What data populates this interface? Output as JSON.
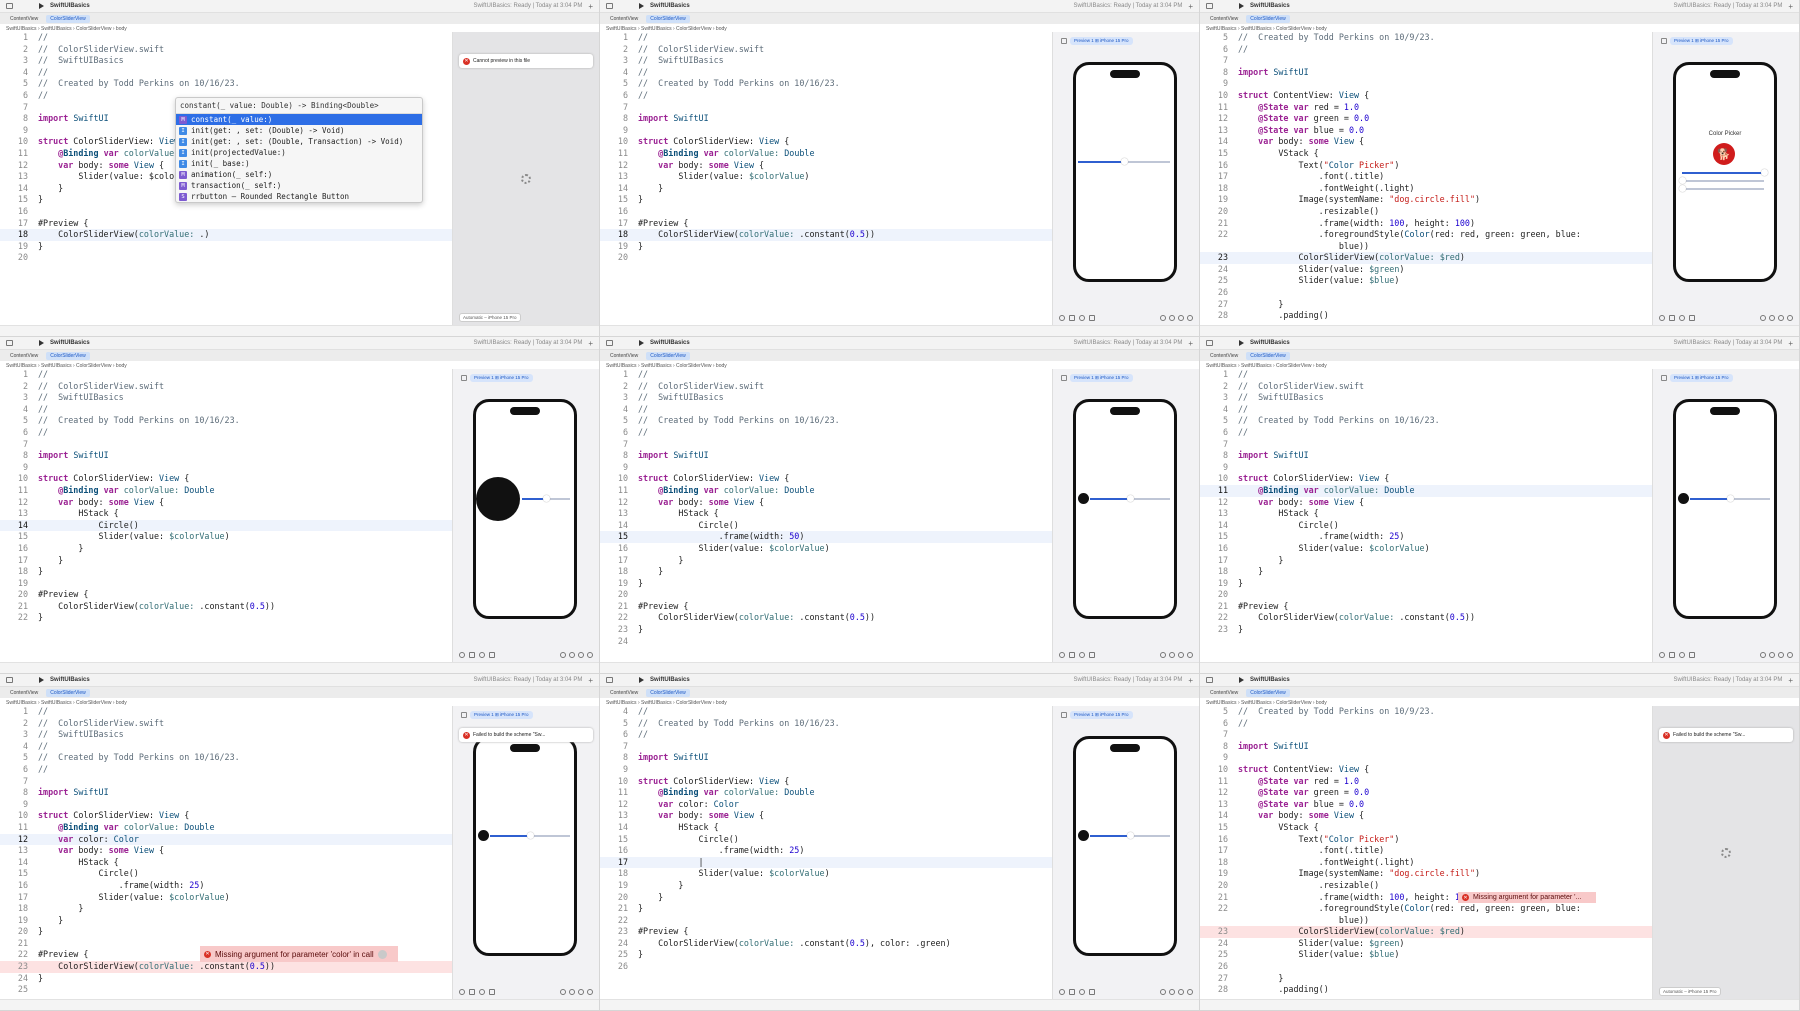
{
  "toolbar": {
    "project": "SwiftUIBasics",
    "status": "SwiftUIBasics: Ready | Today at 3:04 PM"
  },
  "tabs": [
    "ContentView",
    "ColorSliderView"
  ],
  "breadcrumb": "SwiftUIBasics  ›  SwiftUIBasics  ›  ColorSliderView  ›  body",
  "preview_pill": "Preview 1  ⊞ iPhone 15 Pro",
  "device_pill": "Automatic – iPhone 15 Pro",
  "errors": {
    "cannot_preview": "Cannot preview in this file",
    "failed_build": "Failed to build the scheme \"Sw...",
    "missing_color": "Missing argument for parameter 'color' in call",
    "missing_short": "Missing argument for parameter '..."
  },
  "autocomplete": {
    "signature": "constant(_ value: Double) -> Binding<Double>",
    "items": [
      {
        "badge": "M",
        "text": "constant(_ value:)"
      },
      {
        "badge": "I",
        "text": "init(get: , set: (Double) -> Void)"
      },
      {
        "badge": "I",
        "text": "init(get: , set: (Double, Transaction) -> Void)"
      },
      {
        "badge": "I",
        "text": "init(projectedValue:)"
      },
      {
        "badge": "I",
        "text": "init(_ base:)"
      },
      {
        "badge": "M",
        "text": "animation(_ self:)"
      },
      {
        "badge": "M",
        "text": "transaction(_ self:)"
      },
      {
        "badge": "S",
        "text": "rrbutton – Rounded Rectangle Button"
      }
    ]
  },
  "color_picker_title": "Color Picker",
  "panes": [
    {
      "hl": 18,
      "err": 0,
      "lines": [
        [
          "1",
          "//"
        ],
        [
          "2",
          "//  ColorSliderView.swift"
        ],
        [
          "3",
          "//  SwiftUIBasics"
        ],
        [
          "4",
          "//"
        ],
        [
          "5",
          "//  Created by Todd Perkins on 10/16/23."
        ],
        [
          "6",
          "//"
        ],
        [
          "7",
          ""
        ],
        [
          "8",
          "import SwiftUI"
        ],
        [
          "9",
          ""
        ],
        [
          "10",
          "struct ColorSliderView: View {"
        ],
        [
          "11",
          "    @Binding var colorValue: "
        ],
        [
          "12",
          "    var body: some View {"
        ],
        [
          "13",
          "        Slider(value: $colorVal"
        ],
        [
          "14",
          "    }"
        ],
        [
          "15",
          "}"
        ],
        [
          "16",
          ""
        ],
        [
          "17",
          "#Preview {"
        ],
        [
          "18",
          "    ColorSliderView(colorValue: .)"
        ],
        [
          "19",
          "}"
        ],
        [
          "20",
          ""
        ]
      ]
    },
    {
      "hl": 18,
      "err": 0,
      "lines": [
        [
          "1",
          "//"
        ],
        [
          "2",
          "//  ColorSliderView.swift"
        ],
        [
          "3",
          "//  SwiftUIBasics"
        ],
        [
          "4",
          "//"
        ],
        [
          "5",
          "//  Created by Todd Perkins on 10/16/23."
        ],
        [
          "6",
          "//"
        ],
        [
          "7",
          ""
        ],
        [
          "8",
          "import SwiftUI"
        ],
        [
          "9",
          ""
        ],
        [
          "10",
          "struct ColorSliderView: View {"
        ],
        [
          "11",
          "    @Binding var colorValue: Double"
        ],
        [
          "12",
          "    var body: some View {"
        ],
        [
          "13",
          "        Slider(value: $colorValue)"
        ],
        [
          "14",
          "    }"
        ],
        [
          "15",
          "}"
        ],
        [
          "16",
          ""
        ],
        [
          "17",
          "#Preview {"
        ],
        [
          "18",
          "    ColorSliderView(colorValue: .constant(0.5))"
        ],
        [
          "19",
          "}"
        ],
        [
          "20",
          ""
        ]
      ]
    },
    {
      "hl": 23,
      "err": 0,
      "lines": [
        [
          "5",
          "//  Created by Todd Perkins on 10/9/23."
        ],
        [
          "6",
          "//"
        ],
        [
          "7",
          ""
        ],
        [
          "8",
          "import SwiftUI"
        ],
        [
          "9",
          ""
        ],
        [
          "10",
          "struct ContentView: View {"
        ],
        [
          "11",
          "    @State var red = 1.0"
        ],
        [
          "12",
          "    @State var green = 0.0"
        ],
        [
          "13",
          "    @State var blue = 0.0"
        ],
        [
          "14",
          "    var body: some View {"
        ],
        [
          "15",
          "        VStack {"
        ],
        [
          "16",
          "            Text(\"Color Picker\")"
        ],
        [
          "17",
          "                .font(.title)"
        ],
        [
          "18",
          "                .fontWeight(.light)"
        ],
        [
          "19",
          "            Image(systemName: \"dog.circle.fill\")"
        ],
        [
          "20",
          "                .resizable()"
        ],
        [
          "21",
          "                .frame(width: 100, height: 100)"
        ],
        [
          "22",
          "                .foregroundStyle(Color(red: red, green: green, blue:"
        ],
        [
          "",
          "                    blue))"
        ],
        [
          "23",
          "            ColorSliderView(colorValue: $red)"
        ],
        [
          "24",
          "            Slider(value: $green)"
        ],
        [
          "25",
          "            Slider(value: $blue)"
        ],
        [
          "26",
          ""
        ],
        [
          "27",
          "        }"
        ],
        [
          "28",
          "        .padding()"
        ]
      ]
    },
    {
      "hl": 14,
      "err": 0,
      "lines": [
        [
          "1",
          "//"
        ],
        [
          "2",
          "//  ColorSliderView.swift"
        ],
        [
          "3",
          "//  SwiftUIBasics"
        ],
        [
          "4",
          "//"
        ],
        [
          "5",
          "//  Created by Todd Perkins on 10/16/23."
        ],
        [
          "6",
          "//"
        ],
        [
          "7",
          ""
        ],
        [
          "8",
          "import SwiftUI"
        ],
        [
          "9",
          ""
        ],
        [
          "10",
          "struct ColorSliderView: View {"
        ],
        [
          "11",
          "    @Binding var colorValue: Double"
        ],
        [
          "12",
          "    var body: some View {"
        ],
        [
          "13",
          "        HStack {"
        ],
        [
          "14",
          "            Circle()"
        ],
        [
          "15",
          "            Slider(value: $colorValue)"
        ],
        [
          "16",
          "        }"
        ],
        [
          "17",
          "    }"
        ],
        [
          "18",
          "}"
        ],
        [
          "19",
          ""
        ],
        [
          "20",
          "#Preview {"
        ],
        [
          "21",
          "    ColorSliderView(colorValue: .constant(0.5))"
        ],
        [
          "22",
          "}"
        ]
      ]
    },
    {
      "hl": 15,
      "err": 0,
      "lines": [
        [
          "1",
          "//"
        ],
        [
          "2",
          "//  ColorSliderView.swift"
        ],
        [
          "3",
          "//  SwiftUIBasics"
        ],
        [
          "4",
          "//"
        ],
        [
          "5",
          "//  Created by Todd Perkins on 10/16/23."
        ],
        [
          "6",
          "//"
        ],
        [
          "7",
          ""
        ],
        [
          "8",
          "import SwiftUI"
        ],
        [
          "9",
          ""
        ],
        [
          "10",
          "struct ColorSliderView: View {"
        ],
        [
          "11",
          "    @Binding var colorValue: Double"
        ],
        [
          "12",
          "    var body: some View {"
        ],
        [
          "13",
          "        HStack {"
        ],
        [
          "14",
          "            Circle()"
        ],
        [
          "15",
          "                .frame(width: 50)"
        ],
        [
          "16",
          "            Slider(value: $colorValue)"
        ],
        [
          "17",
          "        }"
        ],
        [
          "18",
          "    }"
        ],
        [
          "19",
          "}"
        ],
        [
          "20",
          ""
        ],
        [
          "21",
          "#Preview {"
        ],
        [
          "22",
          "    ColorSliderView(colorValue: .constant(0.5))"
        ],
        [
          "23",
          "}"
        ],
        [
          "24",
          ""
        ]
      ]
    },
    {
      "hl": 11,
      "err": 0,
      "lines": [
        [
          "1",
          "//"
        ],
        [
          "2",
          "//  ColorSliderView.swift"
        ],
        [
          "3",
          "//  SwiftUIBasics"
        ],
        [
          "4",
          "//"
        ],
        [
          "5",
          "//  Created by Todd Perkins on 10/16/23."
        ],
        [
          "6",
          "//"
        ],
        [
          "7",
          ""
        ],
        [
          "8",
          "import SwiftUI"
        ],
        [
          "9",
          ""
        ],
        [
          "10",
          "struct ColorSliderView: View {"
        ],
        [
          "11",
          "    @Binding var colorValue: Double"
        ],
        [
          "12",
          "    var body: some View {"
        ],
        [
          "13",
          "        HStack {"
        ],
        [
          "14",
          "            Circle()"
        ],
        [
          "15",
          "                .frame(width: 25)"
        ],
        [
          "16",
          "            Slider(value: $colorValue)"
        ],
        [
          "17",
          "        }"
        ],
        [
          "18",
          "    }"
        ],
        [
          "19",
          "}"
        ],
        [
          "20",
          ""
        ],
        [
          "21",
          "#Preview {"
        ],
        [
          "22",
          "    ColorSliderView(colorValue: .constant(0.5))"
        ],
        [
          "23",
          "}"
        ]
      ]
    },
    {
      "hl": 12,
      "err": 23,
      "lines": [
        [
          "1",
          "//"
        ],
        [
          "2",
          "//  ColorSliderView.swift"
        ],
        [
          "3",
          "//  SwiftUIBasics"
        ],
        [
          "4",
          "//"
        ],
        [
          "5",
          "//  Created by Todd Perkins on 10/16/23."
        ],
        [
          "6",
          "//"
        ],
        [
          "7",
          ""
        ],
        [
          "8",
          "import SwiftUI"
        ],
        [
          "9",
          ""
        ],
        [
          "10",
          "struct ColorSliderView: View {"
        ],
        [
          "11",
          "    @Binding var colorValue: Double"
        ],
        [
          "12",
          "    var color: Color"
        ],
        [
          "13",
          "    var body: some View {"
        ],
        [
          "14",
          "        HStack {"
        ],
        [
          "15",
          "            Circle()"
        ],
        [
          "16",
          "                .frame(width: 25)"
        ],
        [
          "17",
          "            Slider(value: $colorValue)"
        ],
        [
          "18",
          "        }"
        ],
        [
          "19",
          "    }"
        ],
        [
          "20",
          "}"
        ],
        [
          "21",
          ""
        ],
        [
          "22",
          "#Preview {"
        ],
        [
          "23",
          "    ColorSliderView(colorValue: .constant(0.5))"
        ],
        [
          "24",
          "}"
        ],
        [
          "25",
          ""
        ]
      ]
    },
    {
      "hl": 17,
      "err": 0,
      "lines": [
        [
          "4",
          "//"
        ],
        [
          "5",
          "//  Created by Todd Perkins on 10/16/23."
        ],
        [
          "6",
          "//"
        ],
        [
          "7",
          ""
        ],
        [
          "8",
          "import SwiftUI"
        ],
        [
          "9",
          ""
        ],
        [
          "10",
          "struct ColorSliderView: View {"
        ],
        [
          "11",
          "    @Binding var colorValue: Double"
        ],
        [
          "12",
          "    var color: Color"
        ],
        [
          "13",
          "    var body: some View {"
        ],
        [
          "14",
          "        HStack {"
        ],
        [
          "15",
          "            Circle()"
        ],
        [
          "16",
          "                .frame(width: 25)"
        ],
        [
          "17",
          "            |"
        ],
        [
          "18",
          "            Slider(value: $colorValue)"
        ],
        [
          "19",
          "        }"
        ],
        [
          "20",
          "    }"
        ],
        [
          "21",
          "}"
        ],
        [
          "22",
          ""
        ],
        [
          "23",
          "#Preview {"
        ],
        [
          "24",
          "    ColorSliderView(colorValue: .constant(0.5), color: .green)"
        ],
        [
          "25",
          "}"
        ],
        [
          "26",
          ""
        ]
      ]
    },
    {
      "hl": 0,
      "err": 23,
      "lines": [
        [
          "5",
          "//  Created by Todd Perkins on 10/9/23."
        ],
        [
          "6",
          "//"
        ],
        [
          "7",
          ""
        ],
        [
          "8",
          "import SwiftUI"
        ],
        [
          "9",
          ""
        ],
        [
          "10",
          "struct ContentView: View {"
        ],
        [
          "11",
          "    @State var red = 1.0"
        ],
        [
          "12",
          "    @State var green = 0.0"
        ],
        [
          "13",
          "    @State var blue = 0.0"
        ],
        [
          "14",
          "    var body: some View {"
        ],
        [
          "15",
          "        VStack {"
        ],
        [
          "16",
          "            Text(\"Color Picker\")"
        ],
        [
          "17",
          "                .font(.title)"
        ],
        [
          "18",
          "                .fontWeight(.light)"
        ],
        [
          "19",
          "            Image(systemName: \"dog.circle.fill\")"
        ],
        [
          "20",
          "                .resizable()"
        ],
        [
          "21",
          "                .frame(width: 100, height: 100)"
        ],
        [
          "22",
          "                .foregroundStyle(Color(red: red, green: green, blue:"
        ],
        [
          "",
          "                    blue))"
        ],
        [
          "23",
          "            ColorSliderView(colorValue: $red)"
        ],
        [
          "24",
          "            Slider(value: $green)"
        ],
        [
          "25",
          "            Slider(value: $blue)"
        ],
        [
          "26",
          ""
        ],
        [
          "27",
          "        }"
        ],
        [
          "28",
          "        .padding()"
        ]
      ]
    }
  ]
}
